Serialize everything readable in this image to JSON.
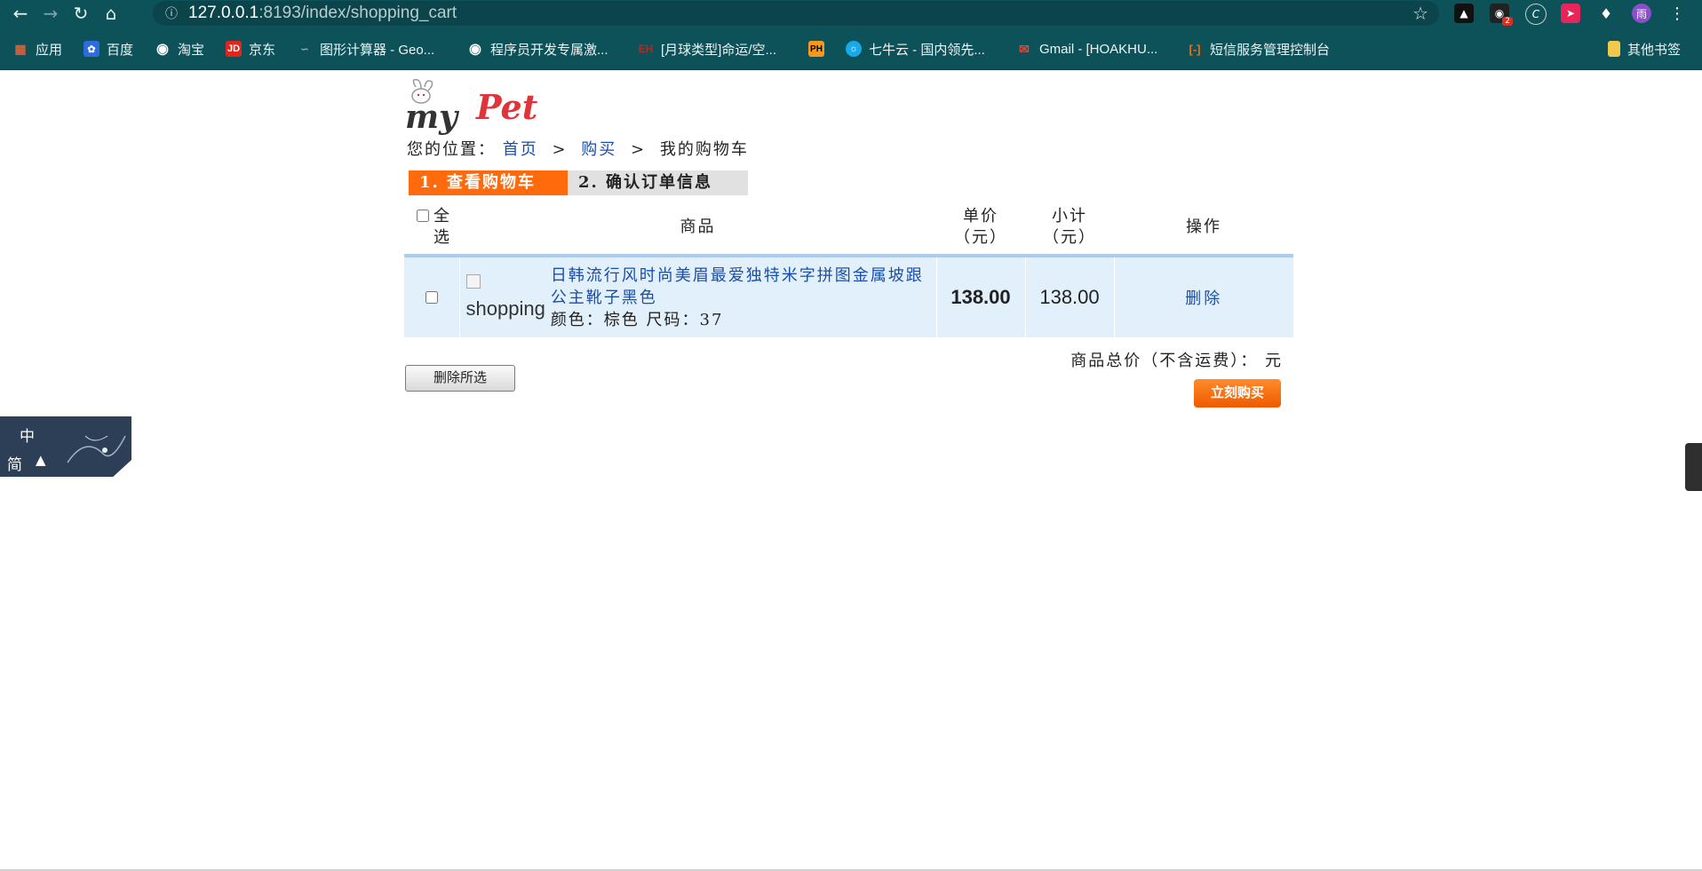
{
  "browser": {
    "url_host": "127.0.0.1",
    "url_rest": ":8193/index/shopping_cart",
    "extension_badge": "2",
    "profile_initial": "雨",
    "bookmarks": [
      {
        "label": "应用",
        "icon": "apps-grid-icon",
        "color": "#e65a2d"
      },
      {
        "label": "百度",
        "icon": "baidu-paw-icon",
        "color": "#2d6cdf"
      },
      {
        "label": "淘宝",
        "icon": "globe-icon",
        "color": "#ffffff"
      },
      {
        "label": "京东",
        "icon": "jd-logo-icon",
        "color": "#e1251b",
        "text": "JD"
      },
      {
        "label": "图形计算器 - Geo...",
        "icon": "graph-icon",
        "color": "#9aa"
      },
      {
        "label": "程序员开发专属激...",
        "icon": "globe-icon",
        "color": "#ffffff"
      },
      {
        "label": "[月球类型]命运/空...",
        "icon": "eh-logo-icon",
        "color": "#7a1a1a",
        "text": "EH"
      },
      {
        "label": "",
        "icon": "ph-logo-icon",
        "color": "#f7971d",
        "text": "PH"
      },
      {
        "label": "七牛云 - 国内领先...",
        "icon": "qiniu-icon",
        "color": "#18a9e8"
      },
      {
        "label": "Gmail - [HOAKHU...",
        "icon": "gmail-icon",
        "color": "#ea4335"
      },
      {
        "label": "短信服务管理控制台",
        "icon": "aliyun-icon",
        "color": "#ff6a00"
      }
    ],
    "other_bookmarks": "其他书签"
  },
  "page": {
    "logo_text_my": "my",
    "logo_text_pet": "Pet",
    "breadcrumb": {
      "prefix": "您的位置：",
      "home": "首页",
      "sep1": ">",
      "buy": "购买",
      "sep2": ">",
      "current": "我的购物车"
    },
    "steps": [
      "1. 查看购物车",
      "2. 确认订单信息"
    ],
    "table": {
      "headers": {
        "select_all": "全选",
        "product": "商品",
        "unit_price_line1": "单价",
        "unit_price_line2": "（元）",
        "subtotal_line1": "小计",
        "subtotal_line2": "（元）",
        "actions": "操作"
      },
      "rows": [
        {
          "image_alt": "shopping",
          "name": "日韩流行风时尚美眉最爱独特米字拼图金属坡跟公主靴子黑色",
          "attrs": "颜色：棕色 尺码：37",
          "unit_price": "138.00",
          "subtotal": "138.00",
          "delete": "删除"
        }
      ]
    },
    "total_label": "商品总价（不含运费）： 元",
    "delete_selected": "删除所选",
    "buy_now": "立刻购买"
  },
  "ime_widget": {
    "line1": "中",
    "line2": "简"
  }
}
